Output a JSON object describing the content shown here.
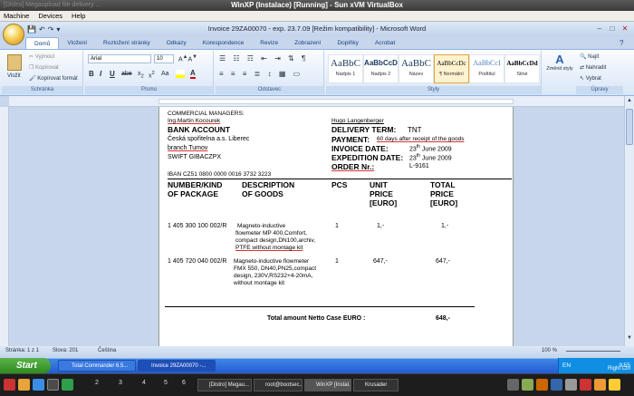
{
  "vbox": {
    "title": "WinXP (Instalace) [Running] - Sun xVM VirtualBox",
    "blur_text": "[Distro] Megaupload file delivery ...",
    "menu": [
      "Machine",
      "Devices",
      "Help"
    ]
  },
  "word": {
    "title": "Invoice 29ZA00070 -  exp. 23.7.09 [Režim kompatibility] - Microsoft Word",
    "tabs": [
      "Domů",
      "Vložení",
      "Rozložení stránky",
      "Odkazy",
      "Korespondence",
      "Revize",
      "Zobrazení",
      "Doplňky",
      "Acrobat"
    ],
    "clipboard": {
      "paste": "Vložit",
      "cut": "Vyjmout",
      "copy": "Kopírovat",
      "format": "Kopírovat formát",
      "label": "Schránka"
    },
    "font": {
      "name": "Arial",
      "size": "10",
      "label": "Písmo"
    },
    "paragraph_label": "Odstavec",
    "styles": [
      {
        "preview": "AaBbC",
        "label": "Nadpis 1"
      },
      {
        "preview": "AaBbCcD",
        "label": "Nadpis 2"
      },
      {
        "preview": "AaBbC",
        "label": "Název"
      },
      {
        "preview": "AaBbCcDc",
        "label": "¶ Normální"
      },
      {
        "preview": "AaBbCcI",
        "label": "Podtitul"
      },
      {
        "preview": "AaBbCcDd",
        "label": "Silné"
      }
    ],
    "styles_label": "Styly",
    "change_styles": "Změnit styly",
    "editing": {
      "find": "Najít",
      "replace": "Nahradit",
      "select": "Vybrat",
      "label": "Úpravy"
    }
  },
  "document": {
    "commercial_managers": "COMMERCIAL MANAGERS:",
    "manager_left": "Ing.Martin Kocourek",
    "manager_right": "Hugo Langenberger",
    "bank_account": "BANK ACCOUNT",
    "bank_name": "Česká spořitelna a.s. Liberec",
    "bank_branch": "branch Tumov",
    "swift": "SWIFT GIBACZPX",
    "iban": "IBAN CZ51 0800 0000 0016 3732 3223",
    "delivery_term_label": "DELIVERY TERM:",
    "delivery_term_value": "TNT",
    "payment_label": "PAYMENT:",
    "payment_value": "60 days after receipt of the goods",
    "invoice_date_label": "INVOICE DATE:",
    "invoice_date_day": "23",
    "invoice_date_sup": "th",
    "invoice_date_rest": "June 2009",
    "expedition_date_label": "EXPEDITION DATE:",
    "expedition_date_day": "23",
    "expedition_date_sup": "th",
    "expedition_date_rest": "June 2009",
    "order_label": "ORDER Nr.:",
    "order_value": "L-9161",
    "headers": {
      "number_l1": "NUMBER/KIND",
      "number_l2": "OF PACKAGE",
      "description_l1": "DESCRIPTION",
      "description_l2": "OF GOODS",
      "pcs": "PCS",
      "unit_l1": "UNIT",
      "unit_l2": "PRICE",
      "unit_l3": "[EURO]",
      "total_l1": "TOTAL",
      "total_l2": "PRICE",
      "total_l3": "[EURO]"
    },
    "rows": [
      {
        "number": "1 405 300 100 002/R",
        "desc": [
          "Magneto-inductive",
          "flowmeter MP 400,Comfort,",
          "compact design,DN100,archiv,",
          "PTFE without montage kit"
        ],
        "pcs": "1",
        "unit": "1,-",
        "total": "1,-"
      },
      {
        "number": "1 405 720 040 002/R",
        "desc": [
          "Magneto-inductive flowmeter",
          "FMX 550, DN40,PN25,compact",
          "design, 230V,RS232+4-20mA,",
          "without montage kit"
        ],
        "pcs": "1",
        "unit": "647,-",
        "total": "647,-"
      }
    ],
    "total_label": "Total amount Netto Case EURO :",
    "total_value": "648,-"
  },
  "status": {
    "page": "Stránka: 1 z 1",
    "words": "Slova: 201",
    "language": "Čeština",
    "zoom": "100 %"
  },
  "taskbar": {
    "start": "Start",
    "items": [
      "Total Commander 6.5...",
      "Invoice 29ZA00070 -..."
    ],
    "lang": "EN",
    "time": "9:55",
    "host_key": "Right Ctrl"
  },
  "hostbar": {
    "workspaces": [
      "2",
      "3",
      "4",
      "5",
      "6"
    ],
    "windows": [
      "[Distro] Megau...",
      "root@bootsec...",
      "WinXP [Instal...",
      "Krusader"
    ]
  }
}
